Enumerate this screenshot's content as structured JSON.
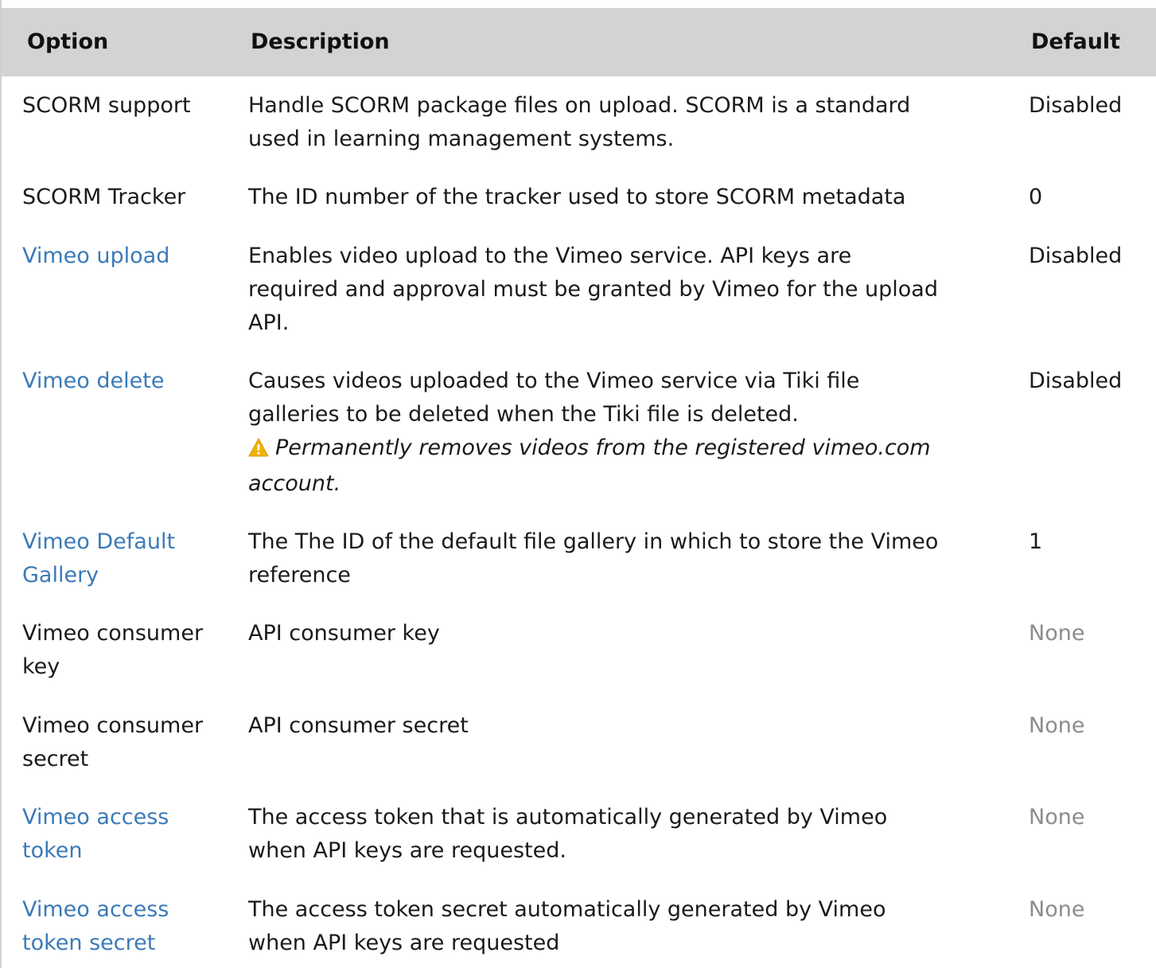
{
  "header": {
    "option": "Option",
    "description": "Description",
    "default": "Default"
  },
  "rows": [
    {
      "option": "SCORM support",
      "option_is_link": false,
      "desc_lines": [
        "Handle SCORM package files on upload. SCORM is a standard",
        "used in learning management systems."
      ],
      "default": "Disabled",
      "default_muted": false
    },
    {
      "option": "SCORM Tracker",
      "option_is_link": false,
      "desc_lines": [
        "The ID number of the tracker used to store SCORM metadata"
      ],
      "default": "0",
      "default_muted": false
    },
    {
      "option": "Vimeo upload",
      "option_is_link": true,
      "desc_lines": [
        "Enables video upload to the Vimeo service. API keys are",
        "required and approval must be granted by Vimeo for the upload",
        "API."
      ],
      "default": "Disabled",
      "default_muted": false
    },
    {
      "option": "Vimeo delete",
      "option_is_link": true,
      "desc_lines": [
        "Causes videos uploaded to the Vimeo service via Tiki file",
        "galleries to be deleted when the Tiki file is deleted."
      ],
      "warning_lines": [
        "Permanently removes videos from the registered vimeo.com",
        "account."
      ],
      "default": "Disabled",
      "default_muted": false
    },
    {
      "option_lines": [
        "Vimeo Default",
        "Gallery"
      ],
      "option_is_link": true,
      "desc_lines": [
        "The The ID of the default file gallery in which to store the Vimeo",
        "reference"
      ],
      "default": "1",
      "default_muted": false
    },
    {
      "option_lines": [
        "Vimeo consumer",
        "key"
      ],
      "option_is_link": false,
      "desc_lines": [
        "API consumer key"
      ],
      "default": "None",
      "default_muted": true
    },
    {
      "option_lines": [
        "Vimeo consumer",
        "secret"
      ],
      "option_is_link": false,
      "desc_lines": [
        "API consumer secret"
      ],
      "default": "None",
      "default_muted": true
    },
    {
      "option_lines": [
        "Vimeo access",
        "token"
      ],
      "option_is_link": true,
      "desc_lines": [
        "The access token that is automatically generated by Vimeo",
        "when API keys are requested."
      ],
      "default": "None",
      "default_muted": true
    },
    {
      "option_lines": [
        "Vimeo access",
        "token secret"
      ],
      "option_is_link": true,
      "desc_lines": [
        "The access token secret automatically generated by Vimeo",
        "when API keys are requested"
      ],
      "default": "None",
      "default_muted": true
    }
  ],
  "colors": {
    "link": "#3a7ab8",
    "muted": "#8c8c8c",
    "header_bg": "#d3d3d3",
    "warning": "#f0b400"
  },
  "icons": {
    "warning": "warning-icon"
  }
}
